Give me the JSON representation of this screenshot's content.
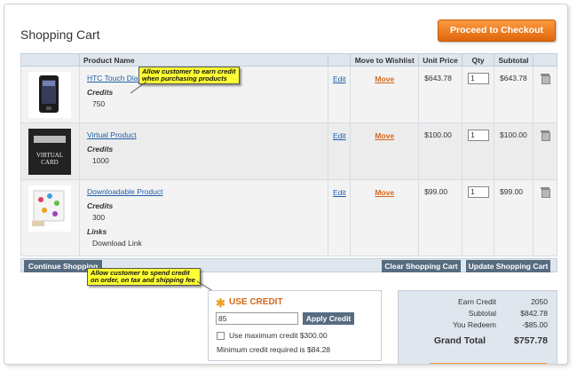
{
  "page": {
    "title": "Shopping Cart",
    "checkout_label": "Proceed to Checkout"
  },
  "table": {
    "headers": {
      "product": "Product Name",
      "wishlist": "Move to Wishlist",
      "unit_price": "Unit Price",
      "qty": "Qty",
      "subtotal": "Subtotal"
    },
    "rows": [
      {
        "name": "HTC Touch Diam",
        "credits_label": "Credits",
        "credits": "750",
        "links_label": "",
        "links": "",
        "edit": "Edit",
        "move": "Move",
        "unit_price": "$643.78",
        "qty": "1",
        "subtotal": "$643.78"
      },
      {
        "name": "Virtual Product",
        "credits_label": "Credits",
        "credits": "1000",
        "links_label": "",
        "links": "",
        "edit": "Edit",
        "move": "Move",
        "unit_price": "$100.00",
        "qty": "1",
        "subtotal": "$100.00",
        "thumb_text": "VIRTUAL CARD"
      },
      {
        "name": "Downloadable Product",
        "credits_label": "Credits",
        "credits": "300",
        "links_label": "Links",
        "links": "Download Link",
        "edit": "Edit",
        "move": "Move",
        "unit_price": "$99.00",
        "qty": "1",
        "subtotal": "$99.00"
      }
    ]
  },
  "buttons": {
    "continue": "Continue Shopping",
    "clear": "Clear Shopping Cart",
    "update": "Update Shopping Cart"
  },
  "tooltips": {
    "earn": "Allow customer to earn credit when purchasing products",
    "spend": "Allow customer to spend credit on order, on tax and shipping fee"
  },
  "credit": {
    "title": "USE CREDIT",
    "input_value": "85",
    "apply_label": "Apply Credit",
    "max_label": "Use maximum credit $300.00",
    "min_required": "Minimum credit required is $84.28"
  },
  "totals": {
    "earn_label": "Earn Credit",
    "earn_value": "2050",
    "subtotal_label": "Subtotal",
    "subtotal_value": "$842.78",
    "redeem_label": "You Redeem",
    "redeem_value": "-$85.00",
    "grand_label": "Grand Total",
    "grand_value": "$757.78"
  },
  "colors": {
    "accent_orange": "#e0660d",
    "link_blue": "#1e5fa8",
    "button_slate": "#566c80",
    "tooltip_yellow": "#ffff33"
  },
  "icons": [
    "trash-icon",
    "star-icon"
  ]
}
